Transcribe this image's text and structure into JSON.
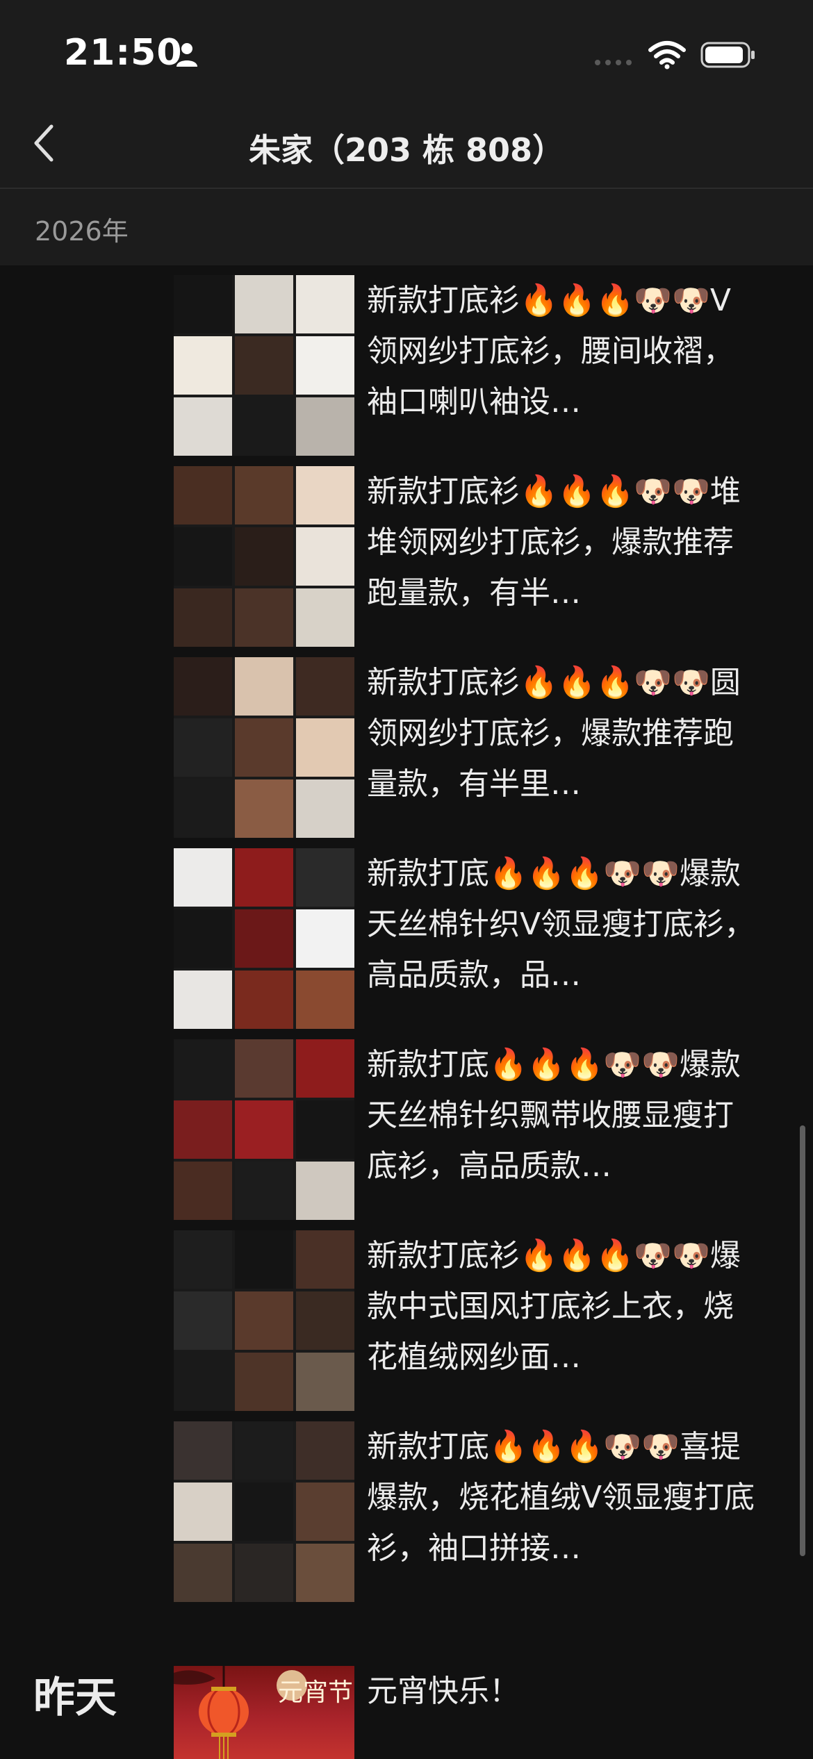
{
  "status_bar": {
    "time": "21:50"
  },
  "nav": {
    "title": "朱家（203 栋 808）"
  },
  "year_header": "2026年",
  "posts": [
    {
      "text": "新款打底衫🔥🔥🔥🐶🐶V领网纱打底衫，腰间收褶，袖口喇叭袖设…",
      "tones": [
        "#151515",
        "#d9d4cc",
        "#ebe7e0",
        "#efe9df",
        "#3b2a22",
        "#f2f0ec",
        "#dedad4",
        "#1a1a1a",
        "#b9b3ab"
      ]
    },
    {
      "text": "新款打底衫🔥🔥🔥🐶🐶堆堆领网纱打底衫，爆款推荐跑量款，有半…",
      "tones": [
        "#4a2e22",
        "#5a3a2a",
        "#e9d6c4",
        "#161616",
        "#2a1e19",
        "#eae3da",
        "#3a2820",
        "#4b3328",
        "#d8d2c8"
      ]
    },
    {
      "text": "新款打底衫🔥🔥🔥🐶🐶圆领网纱打底衫，爆款推荐跑量款，有半里…",
      "tones": [
        "#2b1e1a",
        "#d9c2ad",
        "#3e2a22",
        "#222222",
        "#5a3a2c",
        "#e2c9b2",
        "#1b1b1b",
        "#8a5c44",
        "#d6d0c8"
      ]
    },
    {
      "text": "新款打底🔥🔥🔥🐶🐶爆款天丝棉针织V领显瘦打底衫，高品质款，品…",
      "tones": [
        "#ecebea",
        "#8e1c1c",
        "#2a2a2a",
        "#151515",
        "#6b1818",
        "#f2f2f2",
        "#e8e6e3",
        "#7a2a1e",
        "#8a4a30"
      ]
    },
    {
      "text": "新款打底🔥🔥🔥🐶🐶爆款天丝棉针织飘带收腰显瘦打底衫，高品质款…",
      "tones": [
        "#1a1a1a",
        "#5a3a30",
        "#8e1c1c",
        "#7a1e1e",
        "#9a1f22",
        "#151515",
        "#4a2c22",
        "#1c1c1c",
        "#cfc8bf"
      ]
    },
    {
      "text": "新款打底衫🔥🔥🔥🐶🐶爆款中式国风打底衫上衣，烧花植绒网纱面…",
      "tones": [
        "#1e1e1e",
        "#141414",
        "#4a3026",
        "#2a2a2a",
        "#5a3a2c",
        "#3a2a22",
        "#1a1a1a",
        "#4e3428",
        "#6a5a4c"
      ]
    },
    {
      "text": "新款打底🔥🔥🔥🐶🐶喜提爆款，烧花植绒V领显瘦打底衫，袖口拼接…",
      "tones": [
        "#3a3230",
        "#1c1c1c",
        "#3e2e28",
        "#d8d0c6",
        "#161616",
        "#5a3e30",
        "#4a3a30",
        "#2a2624",
        "#6a4e3c"
      ]
    }
  ],
  "yesterday": {
    "label": "昨天",
    "text": "元宵快乐！",
    "image_text": "元宵节"
  },
  "colors": {
    "background": "#111111",
    "header": "#1c1c1c",
    "text": "#ececec",
    "muted": "#9a9a9a"
  }
}
